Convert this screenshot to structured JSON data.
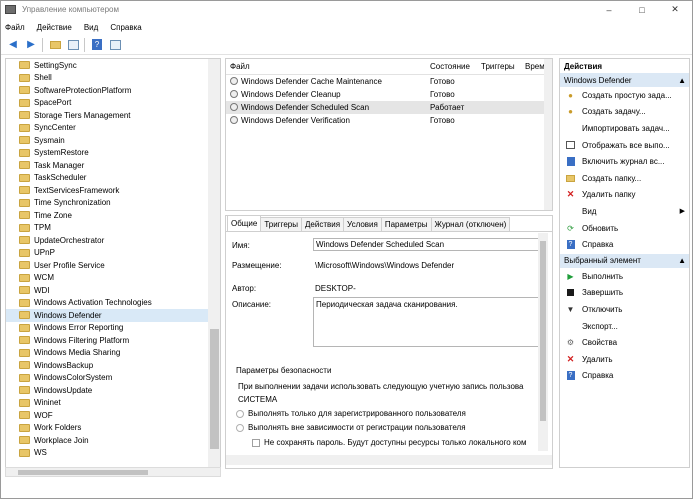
{
  "window": {
    "title": "Управление компьютером"
  },
  "menu": [
    "Файл",
    "Действие",
    "Вид",
    "Справка"
  ],
  "tree": {
    "items": [
      "SettingSync",
      "Shell",
      "SoftwareProtectionPlatform",
      "SpacePort",
      "Storage Tiers Management",
      "SyncCenter",
      "Sysmain",
      "SystemRestore",
      "Task Manager",
      "TaskScheduler",
      "TextServicesFramework",
      "Time Synchronization",
      "Time Zone",
      "TPM",
      "UpdateOrchestrator",
      "UPnP",
      "User Profile Service",
      "WCM",
      "WDI",
      "Windows Activation Technologies",
      "Windows Defender",
      "Windows Error Reporting",
      "Windows Filtering Platform",
      "Windows Media Sharing",
      "WindowsBackup",
      "WindowsColorSystem",
      "WindowsUpdate",
      "Wininet",
      "WOF",
      "Work Folders",
      "Workplace Join",
      "WS"
    ],
    "selected": "Windows Defender"
  },
  "tasks": {
    "headers": [
      "Файл",
      "Состояние",
      "Триггеры",
      "Время"
    ],
    "rows": [
      {
        "name": "Windows Defender Cache Maintenance",
        "state": "Готово"
      },
      {
        "name": "Windows Defender Cleanup",
        "state": "Готово"
      },
      {
        "name": "Windows Defender Scheduled Scan",
        "state": "Работает"
      },
      {
        "name": "Windows Defender Verification",
        "state": "Готово"
      }
    ]
  },
  "details": {
    "tabs": [
      "Общие",
      "Триггеры",
      "Действия",
      "Условия",
      "Параметры",
      "Журнал (отключен)"
    ],
    "name_label": "Имя:",
    "name_value": "Windows Defender Scheduled Scan",
    "location_label": "Размещение:",
    "location_value": "\\Microsoft\\Windows\\Windows Defender",
    "author_label": "Автор:",
    "author_value": "DESKTOP-",
    "desc_label": "Описание:",
    "desc_value": "Периодическая задача сканирования.",
    "security_title": "Параметры безопасности",
    "security_text": "При выполнении задачи использовать следующую учетную запись пользова",
    "account": "СИСТЕМА",
    "radio1": "Выполнять только для зарегистрированного пользователя",
    "radio2": "Выполнять вне зависимости от регистрации пользователя",
    "checkbox": "Не сохранять пароль. Будут доступны ресурсы только локального ком"
  },
  "actions": {
    "title": "Действия",
    "section1": "Windows Defender",
    "items1": [
      {
        "label": "Создать простую зада...",
        "icon": "create-task-icon"
      },
      {
        "label": "Создать задачу...",
        "icon": "create-task-icon"
      },
      {
        "label": "Импортировать задач...",
        "icon": "none"
      },
      {
        "label": "Отображать все выпо...",
        "icon": "list-icon"
      },
      {
        "label": "Включить журнал вс...",
        "icon": "log-icon"
      },
      {
        "label": "Создать папку...",
        "icon": "folder-icon"
      },
      {
        "label": "Удалить папку",
        "icon": "delete-icon"
      },
      {
        "label": "Вид",
        "icon": "none",
        "arrow": true
      },
      {
        "label": "Обновить",
        "icon": "refresh-icon"
      },
      {
        "label": "Справка",
        "icon": "help-icon"
      }
    ],
    "section2": "Выбранный элемент",
    "items2": [
      {
        "label": "Выполнить",
        "icon": "run-icon"
      },
      {
        "label": "Завершить",
        "icon": "end-icon"
      },
      {
        "label": "Отключить",
        "icon": "disable-icon"
      },
      {
        "label": "Экспорт...",
        "icon": "none"
      },
      {
        "label": "Свойства",
        "icon": "properties-icon"
      },
      {
        "label": "Удалить",
        "icon": "delete-icon"
      },
      {
        "label": "Справка",
        "icon": "help-icon"
      }
    ]
  },
  "colors": {
    "selection": "#d9e9f7",
    "section_header": "#dbe8f5",
    "folder": "#e8c668"
  }
}
